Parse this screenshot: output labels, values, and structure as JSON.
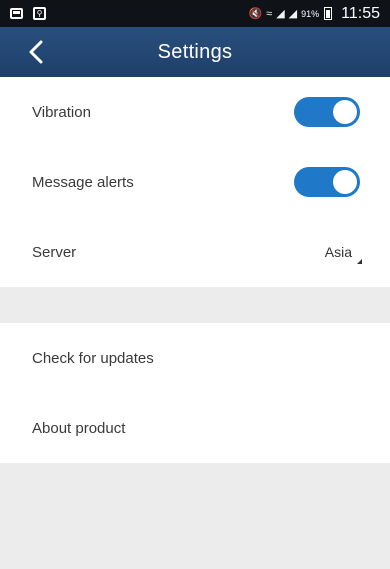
{
  "status_bar": {
    "time": "11:55",
    "battery_percent": "91%",
    "left_icons": [
      "screenshot-icon",
      "search-icon"
    ],
    "right_icons": [
      "mute-icon",
      "wifi-icon",
      "signal-icon",
      "signal-icon",
      "battery-icon"
    ]
  },
  "header": {
    "title": "Settings",
    "back_icon": "chevron-left-icon",
    "background_color": "#24477a"
  },
  "settings": {
    "vibration": {
      "label": "Vibration",
      "enabled": true
    },
    "message_alerts": {
      "label": "Message alerts",
      "enabled": true
    },
    "server": {
      "label": "Server",
      "value": "Asia"
    },
    "check_updates": {
      "label": "Check for updates"
    },
    "about": {
      "label": "About product"
    }
  },
  "colors": {
    "accent": "#1f79c8",
    "divider": "#ececec"
  }
}
